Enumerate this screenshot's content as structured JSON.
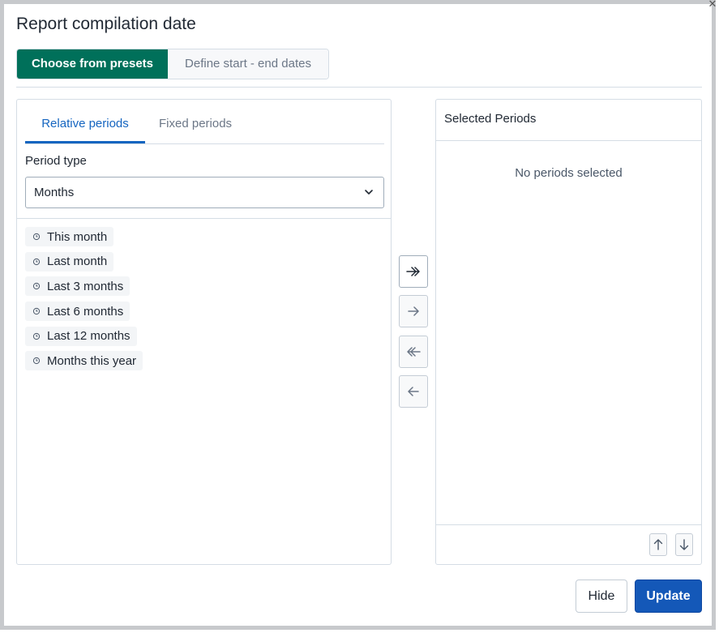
{
  "dialog": {
    "title": "Report compilation date",
    "close_icon": "close-icon"
  },
  "mode_toggle": {
    "options": [
      "Choose from presets",
      "Define start - end dates"
    ],
    "selected": "Choose from presets",
    "accent_color": "#00705a"
  },
  "left_panel": {
    "tabs": [
      "Relative periods",
      "Fixed periods"
    ],
    "active_tab": "Relative periods",
    "period_type": {
      "label": "Period type",
      "value": "Months",
      "icon": "chevron-down-icon"
    },
    "options": [
      {
        "label": "This month",
        "icon": "clock-icon"
      },
      {
        "label": "Last month",
        "icon": "clock-icon"
      },
      {
        "label": "Last 3 months",
        "icon": "clock-icon"
      },
      {
        "label": "Last 6 months",
        "icon": "clock-icon"
      },
      {
        "label": "Last 12 months",
        "icon": "clock-icon"
      },
      {
        "label": "Months this year",
        "icon": "clock-icon"
      }
    ]
  },
  "transfer_buttons": [
    {
      "name": "select-all",
      "icon": "double-arrow-right-icon",
      "enabled": true
    },
    {
      "name": "select-one",
      "icon": "arrow-right-icon",
      "enabled": false
    },
    {
      "name": "deselect-all",
      "icon": "double-arrow-left-icon",
      "enabled": false
    },
    {
      "name": "deselect-one",
      "icon": "arrow-left-icon",
      "enabled": false
    }
  ],
  "right_panel": {
    "title": "Selected Periods",
    "empty_text": "No periods selected",
    "order_buttons": [
      "arrow-up-icon",
      "arrow-down-icon"
    ]
  },
  "footer": {
    "hide_label": "Hide",
    "update_label": "Update",
    "primary_color": "#1458b8"
  }
}
